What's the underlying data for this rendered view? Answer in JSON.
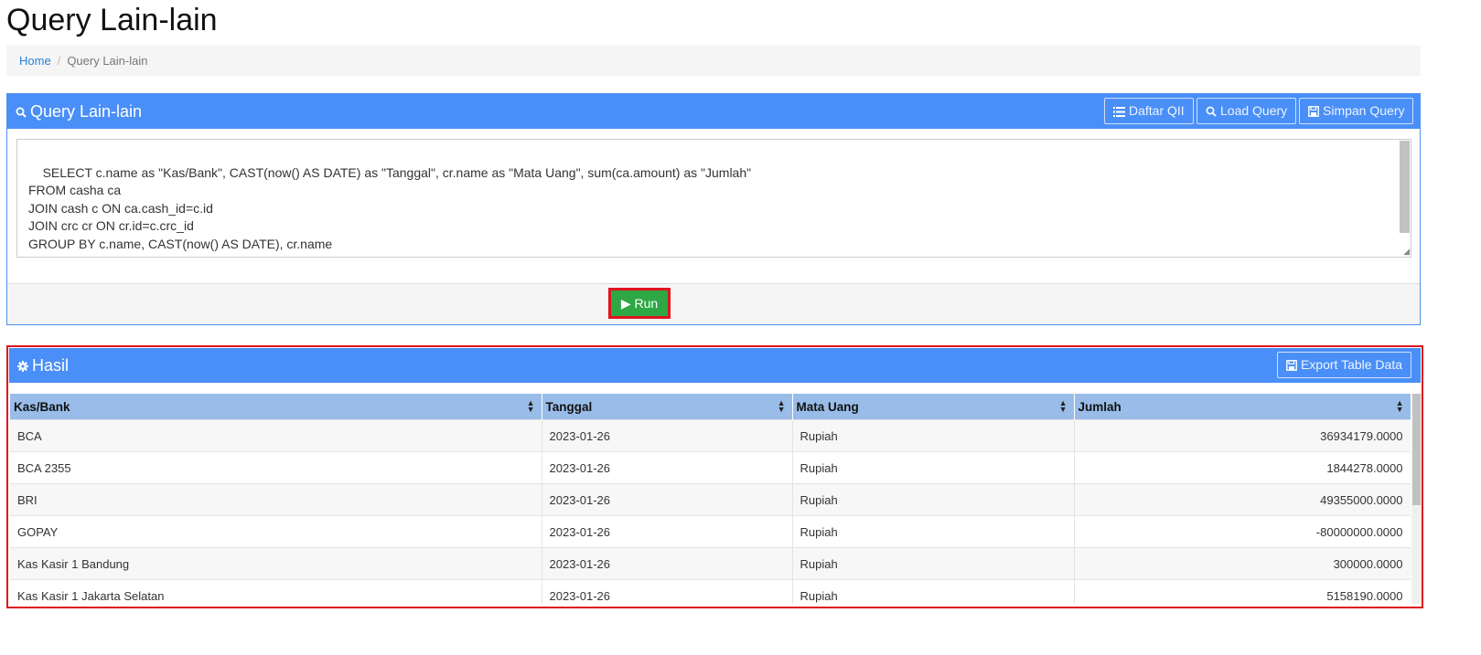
{
  "page": {
    "title": "Query Lain-lain"
  },
  "breadcrumb": {
    "home": "Home",
    "current": "Query Lain-lain"
  },
  "query_panel": {
    "title": "Query Lain-lain",
    "buttons": {
      "daftar": "Daftar QII",
      "load": "Load Query",
      "simpan": "Simpan Query"
    },
    "query_text": "SELECT c.name as \"Kas/Bank\", CAST(now() AS DATE) as \"Tanggal\", cr.name as \"Mata Uang\", sum(ca.amount) as \"Jumlah\"\nFROM casha ca\nJOIN cash c ON ca.cash_id=c.id\nJOIN crc cr ON cr.id=c.crc_id\nGROUP BY c.name, CAST(now() AS DATE), cr.name\nORDER BY c.name;",
    "run_label": "Run"
  },
  "result_panel": {
    "title": "Hasil",
    "export_label": "Export Table Data",
    "columns": [
      "Kas/Bank",
      "Tanggal",
      "Mata Uang",
      "Jumlah"
    ],
    "rows": [
      [
        "BCA",
        "2023-01-26",
        "Rupiah",
        "36934179.0000"
      ],
      [
        "BCA 2355",
        "2023-01-26",
        "Rupiah",
        "1844278.0000"
      ],
      [
        "BRI",
        "2023-01-26",
        "Rupiah",
        "49355000.0000"
      ],
      [
        "GOPAY",
        "2023-01-26",
        "Rupiah",
        "-80000000.0000"
      ],
      [
        "Kas Kasir 1 Bandung",
        "2023-01-26",
        "Rupiah",
        "300000.0000"
      ],
      [
        "Kas Kasir 1 Jakarta Selatan",
        "2023-01-26",
        "Rupiah",
        "5158190.0000"
      ]
    ]
  }
}
